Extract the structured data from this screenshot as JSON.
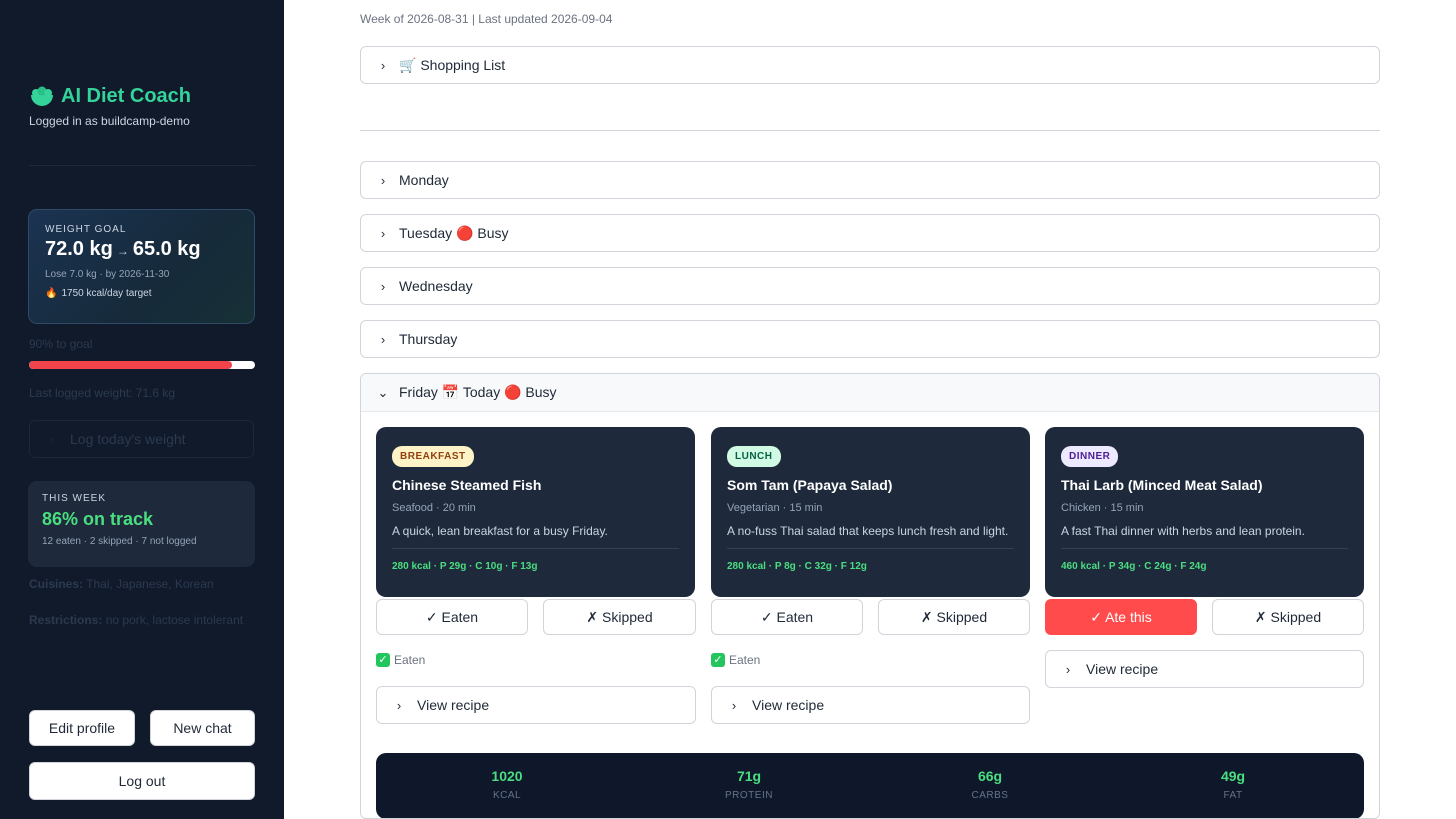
{
  "sidebar": {
    "brand": {
      "icon": "salad-bowl-icon",
      "title": "AI Diet Coach"
    },
    "logged_in": "Logged in as buildcamp-demo",
    "goal": {
      "label": "WEIGHT GOAL",
      "from": "72.0 kg",
      "arrow": "→",
      "to": "65.0 kg",
      "sub": "Lose 7.0 kg · by 2026-11-30",
      "kcal_icon": "fire-icon",
      "kcal": "1750 kcal/day target"
    },
    "progress": {
      "label": "90% to goal",
      "fraction": 0.9
    },
    "last_logged": "Last logged weight: 71.6 kg",
    "log_weight": "Log today's weight",
    "week": {
      "label": "THIS WEEK",
      "pct": "86% on track",
      "sub": "12 eaten · 2 skipped · 7 not logged"
    },
    "cuisines_label": "Cuisines:",
    "cuisines": "Thai, Japanese, Korean",
    "restrictions_label": "Restrictions:",
    "restrictions": "no pork, lactose intolerant",
    "buttons": {
      "edit": "Edit profile",
      "new": "New chat",
      "logout": "Log out"
    }
  },
  "main": {
    "week_header": "Week of 2026-08-31 | Last updated 2026-09-04",
    "shopping": "🛒 Shopping List",
    "days": {
      "monday": "Monday",
      "tuesday": "Tuesday 🔴 Busy",
      "wednesday": "Wednesday",
      "thursday": "Thursday",
      "friday": "Friday 📅 Today 🔴 Busy"
    },
    "meals": [
      {
        "badge": "BREAKFAST",
        "name": "Chinese Steamed Fish",
        "meta": "Seafood · 20 min",
        "desc": "A quick, lean breakfast for a busy Friday.",
        "macros": "280 kcal · P 29g · C 10g · F 13g",
        "eaten_btn": "✓ Eaten",
        "skip_btn": "✗ Skipped",
        "status": "Eaten",
        "recipe": "View recipe"
      },
      {
        "badge": "LUNCH",
        "name": "Som Tam (Papaya Salad)",
        "meta": "Vegetarian · 15 min",
        "desc": "A no-fuss Thai salad that keeps lunch fresh and light.",
        "macros": "280 kcal · P 8g · C 32g · F 12g",
        "eaten_btn": "✓ Eaten",
        "skip_btn": "✗ Skipped",
        "status": "Eaten",
        "recipe": "View recipe"
      },
      {
        "badge": "DINNER",
        "name": "Thai Larb (Minced Meat Salad)",
        "meta": "Chicken · 15 min",
        "desc": "A fast Thai dinner with herbs and lean protein.",
        "macros": "460 kcal · P 34g · C 24g · F 24g",
        "eaten_btn": "✓ Ate this",
        "skip_btn": "✗ Skipped",
        "recipe": "View recipe"
      }
    ],
    "totals": [
      {
        "value": "1020",
        "label": "KCAL"
      },
      {
        "value": "71g",
        "label": "PROTEIN"
      },
      {
        "value": "66g",
        "label": "CARBS"
      },
      {
        "value": "49g",
        "label": "FAT"
      }
    ]
  },
  "colors": {
    "sidebar_bg": "#111a2b",
    "accent_green": "#4ade80",
    "brand_green": "#34d399",
    "active_red": "#ff4b4b",
    "breakfast_badge": "#fef3c7",
    "lunch_badge": "#d1fae5",
    "dinner_badge": "#ede9fe"
  }
}
